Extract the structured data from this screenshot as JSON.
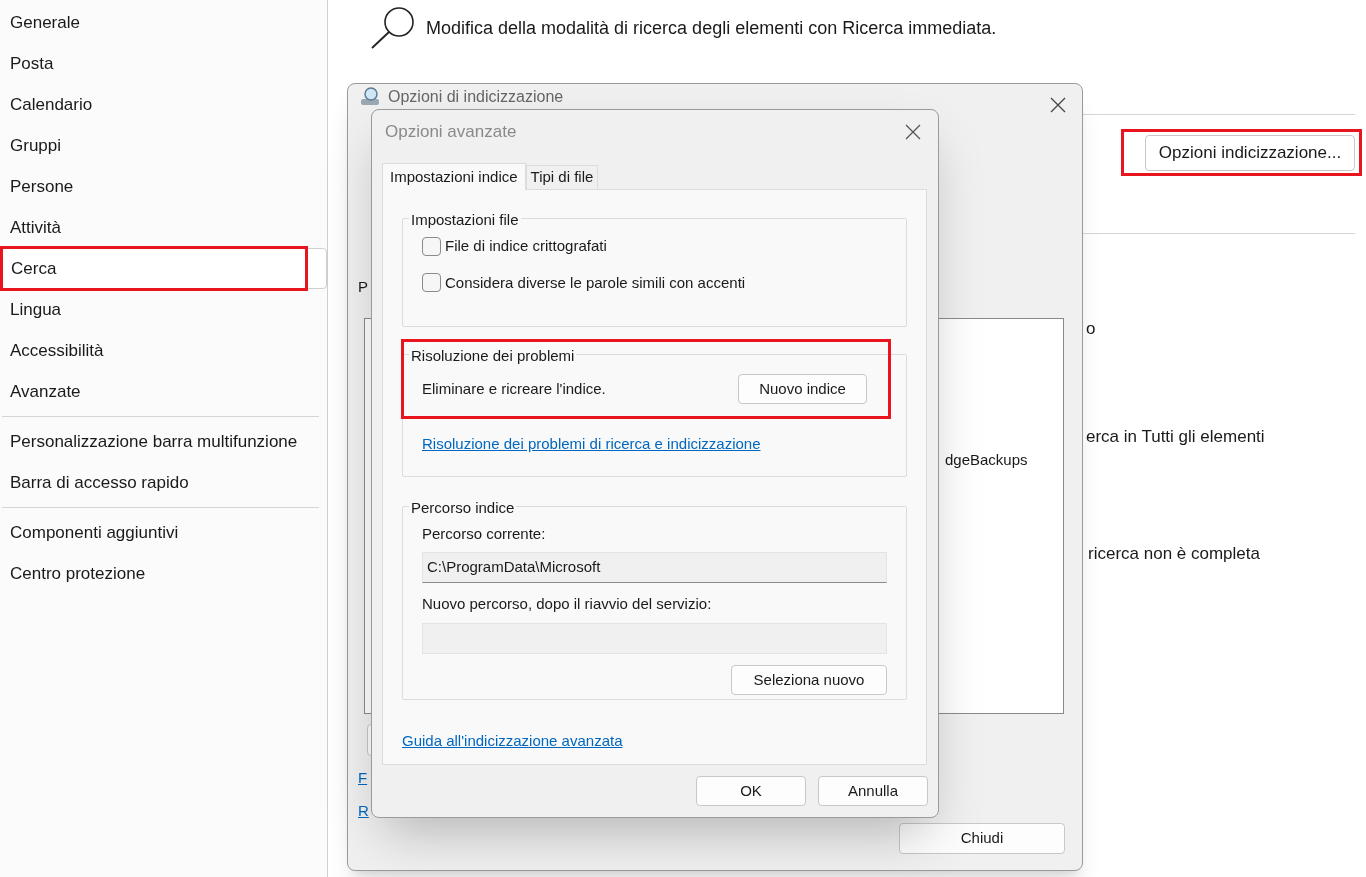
{
  "sidebar": {
    "sections": [
      {
        "items": [
          {
            "label": "Generale",
            "selected": false,
            "highlighted": false
          },
          {
            "label": "Posta",
            "selected": false,
            "highlighted": false
          },
          {
            "label": "Calendario",
            "selected": false,
            "highlighted": false
          },
          {
            "label": "Gruppi",
            "selected": false,
            "highlighted": false
          },
          {
            "label": "Persone",
            "selected": false,
            "highlighted": false
          },
          {
            "label": "Attività",
            "selected": false,
            "highlighted": false
          },
          {
            "label": "Cerca",
            "selected": true,
            "highlighted": true
          },
          {
            "label": "Lingua",
            "selected": false,
            "highlighted": false
          },
          {
            "label": "Accessibilità",
            "selected": false,
            "highlighted": false
          },
          {
            "label": "Avanzate",
            "selected": false,
            "highlighted": false
          }
        ]
      },
      {
        "items": [
          {
            "label": "Personalizzazione barra multifunzione",
            "selected": false,
            "highlighted": false
          },
          {
            "label": "Barra di accesso rapido",
            "selected": false,
            "highlighted": false
          }
        ]
      },
      {
        "items": [
          {
            "label": "Componenti aggiuntivi",
            "selected": false,
            "highlighted": false
          },
          {
            "label": "Centro protezione",
            "selected": false,
            "highlighted": false
          }
        ]
      }
    ]
  },
  "main": {
    "description": "Modifica della modalità di ricerca degli elementi con Ricerca immediata.",
    "indexing_button": {
      "label": "Opzioni indicizzazione...",
      "highlighted": true
    },
    "partial_texts": [
      "o",
      "erca in Tutti gli elementi",
      "ricerca non è completa"
    ]
  },
  "indexing_dialog": {
    "title": "Opzioni di indicizzazione",
    "label_fragment": "P",
    "list_item_fragment": "dgeBackups",
    "link_fragments": [
      "F",
      "R"
    ],
    "close_button": "Chiudi"
  },
  "advanced_dialog": {
    "title": "Opzioni avanzate",
    "tabs": [
      {
        "label": "Impostazioni indice",
        "selected": true
      },
      {
        "label": "Tipi di file",
        "selected": false
      }
    ],
    "file_settings": {
      "title": "Impostazioni file",
      "checkboxes": [
        {
          "label": "File di indice crittografati",
          "checked": false
        },
        {
          "label": "Considera diverse le parole simili con accenti",
          "checked": false
        }
      ]
    },
    "troubleshooting": {
      "title": "Risoluzione dei problemi",
      "text": "Eliminare e ricreare l'indice.",
      "button": "Nuovo indice",
      "highlighted": true,
      "link": "Risoluzione dei problemi di ricerca e indicizzazione"
    },
    "index_location": {
      "title": "Percorso indice",
      "current_label": "Percorso corrente:",
      "current_value": "C:\\ProgramData\\Microsoft",
      "new_label": "Nuovo percorso, dopo il riavvio del servizio:",
      "button": "Seleziona nuovo"
    },
    "help_link": "Guida all'indicizzazione avanzata",
    "buttons": [
      "OK",
      "Annulla"
    ]
  }
}
